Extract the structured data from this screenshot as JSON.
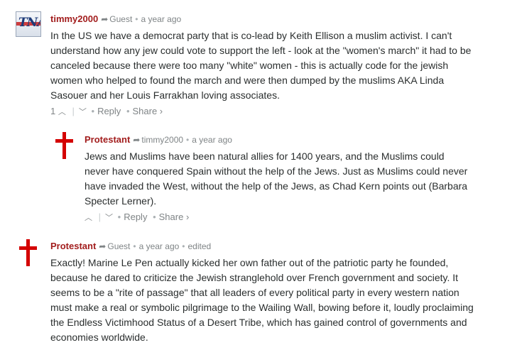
{
  "comments": [
    {
      "author": "timmy2000",
      "reply_to": "Guest",
      "time": "a year ago",
      "edited": "",
      "avatar_icon": "tna-logo-avatar",
      "avatar_text": "TNA",
      "text": "In the US we have a democrat party that is co-lead by Keith Ellison a muslim activist. I can't understand how any jew could vote to support the left - look at the \"women's march\" it had to be canceled because there were too many \"white\" women - this is actually code for the jewish women who helped to found the march and were then dumped by the muslims AKA Linda Sasouer and her Louis Farrakhan loving associates.",
      "votes": "1",
      "reply_label": "Reply",
      "share_label": "Share ›"
    },
    {
      "author": "Protestant",
      "reply_to": "timmy2000",
      "time": "a year ago",
      "edited": "",
      "avatar_icon": "red-cross-avatar",
      "text": "Jews and Muslims have been natural allies for 1400 years, and the Muslims could never have conquered Spain without the help of the Jews. Just as Muslims could never have invaded the West, without the help of the Jews, as Chad Kern points out (Barbara Specter Lerner).",
      "votes": "",
      "reply_label": "Reply",
      "share_label": "Share ›"
    },
    {
      "author": "Protestant",
      "reply_to": "Guest",
      "time": "a year ago",
      "edited": "edited",
      "avatar_icon": "red-cross-avatar",
      "text": "Exactly! Marine Le Pen actually kicked her own father out of the patriotic party he founded, because he dared to criticize the Jewish stranglehold over French government and society. It seems to be a \"rite of passage\" that all leaders of every political party in every western nation must make a real or symbolic pilgrimage to the Wailing Wall, bowing before it, loudly proclaiming the Endless Victimhood Status of a Desert Tribe, which has gained control of governments and economies worldwide."
    }
  ],
  "colors": {
    "author": "#a21d1d",
    "cross": "#d40000",
    "meta": "#7f8486"
  }
}
